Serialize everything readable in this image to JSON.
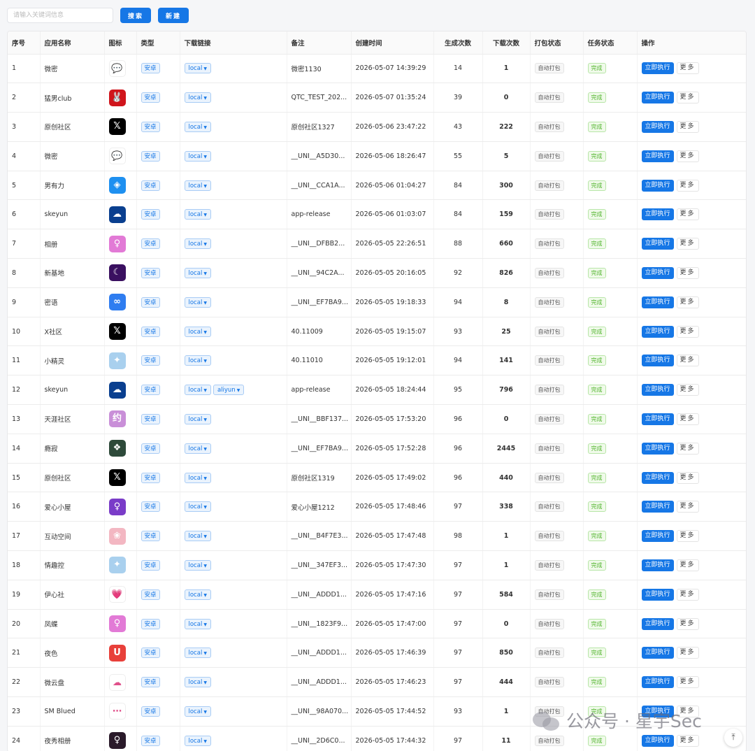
{
  "toolbar": {
    "search_placeholder": "请输入关键词信息",
    "search_button": "搜索",
    "new_button": "新建"
  },
  "table": {
    "headers": {
      "index": "序号",
      "name": "应用名称",
      "icon": "图标",
      "type": "类型",
      "link": "下载链接",
      "remark": "备注",
      "created": "创建时间",
      "gen": "生成次数",
      "dl": "下载次数",
      "pack": "打包状态",
      "task": "任务状态",
      "ops": "操作"
    },
    "rows": [
      {
        "index": "1",
        "name": "微密",
        "icon": "chat-bubble-icon",
        "icon_bg": "#ffffff",
        "icon_glyph": "💬",
        "type": "安卓",
        "links": [
          "local"
        ],
        "remark": "微密1130",
        "created": "2026-05-07 14:39:29",
        "gen": "14",
        "dl": "1",
        "pack": "自动打包",
        "task": "完成",
        "exec": "立即执行",
        "more": "更多"
      },
      {
        "index": "2",
        "name": "猛男club",
        "icon": "rabbit-logo-icon",
        "icon_bg": "#d0151c",
        "icon_glyph": "🐰",
        "type": "安卓",
        "links": [
          "local"
        ],
        "remark": "QTC_TEST_202...",
        "created": "2026-05-07 01:35:24",
        "gen": "39",
        "dl": "0",
        "pack": "自动打包",
        "task": "完成",
        "exec": "立即执行",
        "more": "更多"
      },
      {
        "index": "3",
        "name": "原创社区",
        "icon": "x-logo-icon",
        "icon_bg": "#000000",
        "icon_glyph": "𝕏",
        "type": "安卓",
        "links": [
          "local"
        ],
        "remark": "原创社区1327",
        "created": "2026-05-06 23:47:22",
        "gen": "43",
        "dl": "222",
        "pack": "自动打包",
        "task": "完成",
        "exec": "立即执行",
        "more": "更多"
      },
      {
        "index": "4",
        "name": "微密",
        "icon": "chat-bubble-icon",
        "icon_bg": "#ffffff",
        "icon_glyph": "💬",
        "type": "安卓",
        "links": [
          "local"
        ],
        "remark": "__UNI__A5D30...",
        "created": "2026-05-06 18:26:47",
        "gen": "55",
        "dl": "5",
        "pack": "自动打包",
        "task": "完成",
        "exec": "立即执行",
        "more": "更多"
      },
      {
        "index": "5",
        "name": "男有力",
        "icon": "blue-app-icon",
        "icon_bg": "#1e90f0",
        "icon_glyph": "◈",
        "type": "安卓",
        "links": [
          "local"
        ],
        "remark": "__UNI__CCA1A...",
        "created": "2026-05-06 01:04:27",
        "gen": "84",
        "dl": "300",
        "pack": "自动打包",
        "task": "完成",
        "exec": "立即执行",
        "more": "更多"
      },
      {
        "index": "6",
        "name": "skeyun",
        "icon": "cloud-icon",
        "icon_bg": "#0a3f8f",
        "icon_glyph": "☁",
        "type": "安卓",
        "links": [
          "local"
        ],
        "remark": "app-release",
        "created": "2026-05-06 01:03:07",
        "gen": "84",
        "dl": "159",
        "pack": "自动打包",
        "task": "完成",
        "exec": "立即执行",
        "more": "更多"
      },
      {
        "index": "7",
        "name": "相册",
        "icon": "portrait-icon",
        "icon_bg": "#e27ad6",
        "icon_glyph": "♀",
        "type": "安卓",
        "links": [
          "local"
        ],
        "remark": "__UNI__DFBB2...",
        "created": "2026-05-05 22:26:51",
        "gen": "88",
        "dl": "660",
        "pack": "自动打包",
        "task": "完成",
        "exec": "立即执行",
        "more": "更多"
      },
      {
        "index": "8",
        "name": "新基地",
        "icon": "moon-icon",
        "icon_bg": "#3a1060",
        "icon_glyph": "☾",
        "type": "安卓",
        "links": [
          "local"
        ],
        "remark": "__UNI__94C2A...",
        "created": "2026-05-05 20:16:05",
        "gen": "92",
        "dl": "826",
        "pack": "自动打包",
        "task": "完成",
        "exec": "立即执行",
        "more": "更多"
      },
      {
        "index": "9",
        "name": "密语",
        "icon": "double-circle-icon",
        "icon_bg": "#2f7df0",
        "icon_glyph": "∞",
        "type": "安卓",
        "links": [
          "local"
        ],
        "remark": "__UNI__EF7BA9...",
        "created": "2026-05-05 19:18:33",
        "gen": "94",
        "dl": "8",
        "pack": "自动打包",
        "task": "完成",
        "exec": "立即执行",
        "more": "更多"
      },
      {
        "index": "10",
        "name": "X社区",
        "icon": "x-logo-icon",
        "icon_bg": "#000000",
        "icon_glyph": "𝕏",
        "type": "安卓",
        "links": [
          "local"
        ],
        "remark": "40.11009",
        "created": "2026-05-05 19:15:07",
        "gen": "93",
        "dl": "25",
        "pack": "自动打包",
        "task": "完成",
        "exec": "立即执行",
        "more": "更多"
      },
      {
        "index": "11",
        "name": "小精灵",
        "icon": "sprite-icon",
        "icon_bg": "#a9d0ee",
        "icon_glyph": "✦",
        "type": "安卓",
        "links": [
          "local"
        ],
        "remark": "40.11010",
        "created": "2026-05-05 19:12:01",
        "gen": "94",
        "dl": "141",
        "pack": "自动打包",
        "task": "完成",
        "exec": "立即执行",
        "more": "更多"
      },
      {
        "index": "12",
        "name": "skeyun",
        "icon": "cloud-icon",
        "icon_bg": "#0a3f8f",
        "icon_glyph": "☁",
        "type": "安卓",
        "links": [
          "local",
          "aliyun"
        ],
        "remark": "app-release",
        "created": "2026-05-05 18:24:44",
        "gen": "95",
        "dl": "796",
        "pack": "自动打包",
        "task": "完成",
        "exec": "立即执行",
        "more": "更多"
      },
      {
        "index": "13",
        "name": "天涯社区",
        "icon": "yue-icon",
        "icon_bg": "#c98fd8",
        "icon_glyph": "约",
        "type": "安卓",
        "links": [
          "local"
        ],
        "remark": "__UNI__BBF137...",
        "created": "2026-05-05 17:53:20",
        "gen": "96",
        "dl": "0",
        "pack": "自动打包",
        "task": "完成",
        "exec": "立即执行",
        "more": "更多"
      },
      {
        "index": "14",
        "name": "瘾寂",
        "icon": "emblem-icon",
        "icon_bg": "#2e4a3a",
        "icon_glyph": "❖",
        "type": "安卓",
        "links": [
          "local"
        ],
        "remark": "__UNI__EF7BA9...",
        "created": "2026-05-05 17:52:28",
        "gen": "96",
        "dl": "2445",
        "pack": "自动打包",
        "task": "完成",
        "exec": "立即执行",
        "more": "更多"
      },
      {
        "index": "15",
        "name": "原创社区",
        "icon": "x-logo-icon",
        "icon_bg": "#000000",
        "icon_glyph": "𝕏",
        "type": "安卓",
        "links": [
          "local"
        ],
        "remark": "原创社区1319",
        "created": "2026-05-05 17:49:02",
        "gen": "96",
        "dl": "440",
        "pack": "自动打包",
        "task": "完成",
        "exec": "立即执行",
        "more": "更多"
      },
      {
        "index": "16",
        "name": "爱心小屋",
        "icon": "silhouette-icon",
        "icon_bg": "#7a3cc8",
        "icon_glyph": "♀",
        "type": "安卓",
        "links": [
          "local"
        ],
        "remark": "爱心小屋1212",
        "created": "2026-05-05 17:48:46",
        "gen": "97",
        "dl": "338",
        "pack": "自动打包",
        "task": "完成",
        "exec": "立即执行",
        "more": "更多"
      },
      {
        "index": "17",
        "name": "互动空间",
        "icon": "pink-photo-icon",
        "icon_bg": "#f3b7c2",
        "icon_glyph": "❀",
        "type": "安卓",
        "links": [
          "local"
        ],
        "remark": "__UNI__B4F7E3...",
        "created": "2026-05-05 17:47:48",
        "gen": "98",
        "dl": "1",
        "pack": "自动打包",
        "task": "完成",
        "exec": "立即执行",
        "more": "更多"
      },
      {
        "index": "18",
        "name": "情趣控",
        "icon": "sprite-icon",
        "icon_bg": "#a9d0ee",
        "icon_glyph": "✦",
        "type": "安卓",
        "links": [
          "local"
        ],
        "remark": "__UNI__347EF3...",
        "created": "2026-05-05 17:47:30",
        "gen": "97",
        "dl": "1",
        "pack": "自动打包",
        "task": "完成",
        "exec": "立即执行",
        "more": "更多"
      },
      {
        "index": "19",
        "name": "伊心社",
        "icon": "heart-icon",
        "icon_bg": "#ffffff",
        "icon_glyph": "💗",
        "type": "安卓",
        "links": [
          "local"
        ],
        "remark": "__UNI__ADDD1...",
        "created": "2026-05-05 17:47:16",
        "gen": "97",
        "dl": "584",
        "pack": "自动打包",
        "task": "完成",
        "exec": "立即执行",
        "more": "更多"
      },
      {
        "index": "20",
        "name": "凤蝶",
        "icon": "portrait-icon",
        "icon_bg": "#e27ad6",
        "icon_glyph": "♀",
        "type": "安卓",
        "links": [
          "local"
        ],
        "remark": "__UNI__1823F9...",
        "created": "2026-05-05 17:47:00",
        "gen": "97",
        "dl": "0",
        "pack": "自动打包",
        "task": "完成",
        "exec": "立即执行",
        "more": "更多"
      },
      {
        "index": "21",
        "name": "夜色",
        "icon": "u-logo-icon",
        "icon_bg": "#e8403a",
        "icon_glyph": "U",
        "type": "安卓",
        "links": [
          "local"
        ],
        "remark": "__UNI__ADDD1...",
        "created": "2026-05-05 17:46:39",
        "gen": "97",
        "dl": "850",
        "pack": "自动打包",
        "task": "完成",
        "exec": "立即执行",
        "more": "更多"
      },
      {
        "index": "22",
        "name": "微云盘",
        "icon": "cloud-disk-icon",
        "icon_bg": "#ffffff",
        "icon_glyph": "☁",
        "type": "安卓",
        "links": [
          "local"
        ],
        "remark": "__UNI__ADDD1...",
        "created": "2026-05-05 17:46:23",
        "gen": "97",
        "dl": "444",
        "pack": "自动打包",
        "task": "完成",
        "exec": "立即执行",
        "more": "更多"
      },
      {
        "index": "23",
        "name": "SM Blued",
        "icon": "chat-dots-icon",
        "icon_bg": "#ffffff",
        "icon_glyph": "⋯",
        "type": "安卓",
        "links": [
          "local"
        ],
        "remark": "__UNI__98A070...",
        "created": "2026-05-05 17:44:52",
        "gen": "93",
        "dl": "1",
        "pack": "自动打包",
        "task": "完成",
        "exec": "立即执行",
        "more": "更多"
      },
      {
        "index": "24",
        "name": "夜秀相册",
        "icon": "girl-icon",
        "icon_bg": "#2a1a2a",
        "icon_glyph": "♀",
        "type": "安卓",
        "links": [
          "local"
        ],
        "remark": "__UNI__2D6C0...",
        "created": "2026-05-05 17:44:32",
        "gen": "97",
        "dl": "11",
        "pack": "自动打包",
        "task": "完成",
        "exec": "立即执行",
        "more": "更多"
      }
    ]
  },
  "watermark": {
    "text": "公众号 · 星宇Sec",
    "icon": "wechat-icon"
  },
  "back_top": {
    "icon": "back-to-top-icon",
    "glyph": "⤒"
  },
  "colors": {
    "primary": "#1677e6",
    "success": "#52b52f"
  }
}
